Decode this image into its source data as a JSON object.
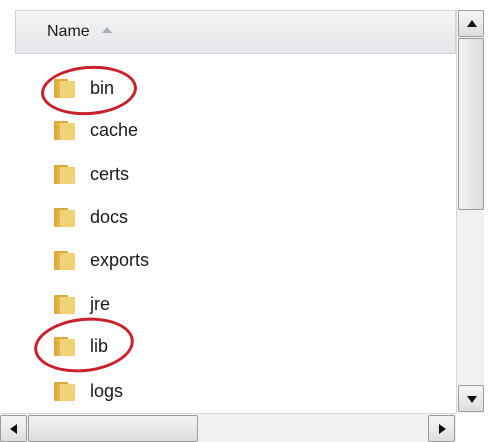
{
  "header": {
    "name_label": "Name",
    "sort": "ascending"
  },
  "files": [
    {
      "label": "bin",
      "icon": "folder-icon",
      "highlighted": true
    },
    {
      "label": "cache",
      "icon": "folder-icon",
      "highlighted": false
    },
    {
      "label": "certs",
      "icon": "folder-icon",
      "highlighted": false
    },
    {
      "label": "docs",
      "icon": "folder-icon",
      "highlighted": false
    },
    {
      "label": "exports",
      "icon": "folder-icon",
      "highlighted": false
    },
    {
      "label": "jre",
      "icon": "folder-icon",
      "highlighted": false
    },
    {
      "label": "lib",
      "icon": "folder-icon",
      "highlighted": true
    },
    {
      "label": "logs",
      "icon": "folder-icon",
      "highlighted": false
    }
  ],
  "colors": {
    "annotation": "#c8202c",
    "folder": "#e9c35c"
  }
}
